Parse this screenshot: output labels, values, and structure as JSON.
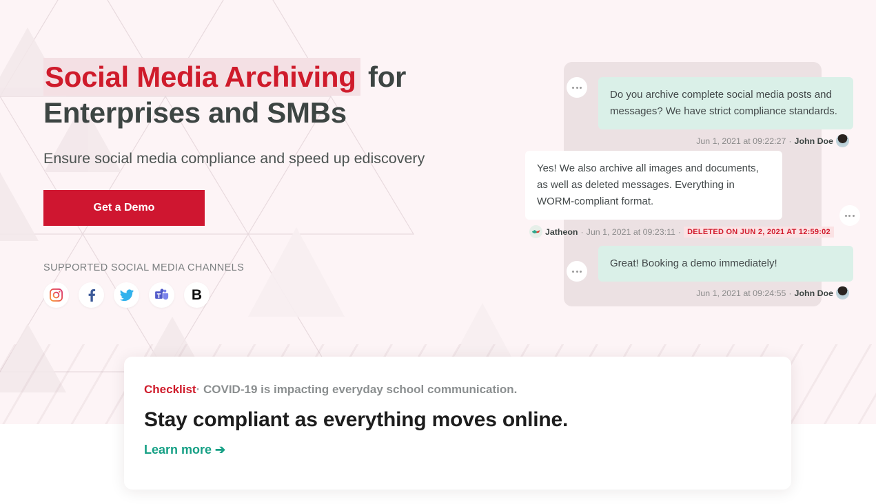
{
  "hero": {
    "headline_highlight": "Social Media Archiving",
    "headline_rest": " for Enterprises and SMBs",
    "subheadline": "Ensure social media compliance and speed up ediscovery",
    "cta_label": "Get a Demo",
    "channels_label": "SUPPORTED SOCIAL MEDIA CHANNELS",
    "channels": [
      {
        "name": "instagram",
        "title": "Instagram"
      },
      {
        "name": "facebook",
        "title": "Facebook"
      },
      {
        "name": "twitter",
        "title": "Twitter"
      },
      {
        "name": "microsoft-teams",
        "title": "Microsoft Teams"
      },
      {
        "name": "bloomberg",
        "title": "Bloomberg",
        "glyph": "B"
      }
    ]
  },
  "chat": {
    "messages": [
      {
        "text": "Do you archive complete social media posts and messages? We have strict compliance standards.",
        "timestamp": "Jun 1, 2021 at 09:22:27",
        "separator": "·",
        "author": "John Doe",
        "style": "mint"
      },
      {
        "text": "Yes! We also archive all images and documents, as well as deleted messages. Everything in WORM-compliant format.",
        "author": "Jatheon",
        "timestamp": "Jun 1, 2021 at 09:23:11",
        "separator": "·",
        "deleted_badge": "DELETED ON JUN 2, 2021 AT 12:59:02",
        "style": "white"
      },
      {
        "text": "Great! Booking a demo immediately!",
        "timestamp": "Jun 1, 2021 at 09:24:55",
        "separator": "·",
        "author": "John Doe",
        "style": "mint"
      }
    ]
  },
  "promo": {
    "kicker_tag": "Checklist",
    "kicker_separator": "·",
    "kicker_text": "COVID-19 is impacting everyday school communication.",
    "title": "Stay compliant as everything moves online.",
    "link_label": "Learn more ➔"
  },
  "colors": {
    "brand_red": "#cf1630",
    "accent_red": "#cf1b2b",
    "teal": "#16a085",
    "page_bg": "#fdf4f6",
    "chat_bg": "#ece1e3",
    "bubble_mint": "#daf0e8"
  }
}
